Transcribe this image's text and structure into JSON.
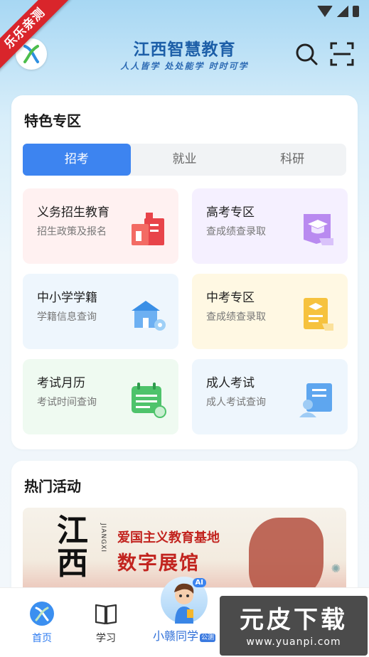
{
  "ribbon": "乐乐亲测",
  "header": {
    "title": "江西智慧教育",
    "slogan": "人人皆学 处处能学 时时可学"
  },
  "featured": {
    "title": "特色专区",
    "tabs": [
      {
        "label": "招考",
        "active": true
      },
      {
        "label": "就业",
        "active": false
      },
      {
        "label": "科研",
        "active": false
      }
    ],
    "tiles": [
      {
        "title": "义务招生教育",
        "subtitle": "招生政策及报名",
        "icon": "school-building-icon",
        "bg": "#fff1f1"
      },
      {
        "title": "高考专区",
        "subtitle": "查成绩查录取",
        "icon": "graduation-book-icon",
        "bg": "#f5f0ff"
      },
      {
        "title": "中小学学籍",
        "subtitle": "学籍信息查询",
        "icon": "school-house-icon",
        "bg": "#eef6fd"
      },
      {
        "title": "中考专区",
        "subtitle": "查成绩查录取",
        "icon": "certificate-icon",
        "bg": "#fff8e3"
      },
      {
        "title": "考试月历",
        "subtitle": "考试时间查询",
        "icon": "calendar-icon",
        "bg": "#effaf1"
      },
      {
        "title": "成人考试",
        "subtitle": "成人考试查询",
        "icon": "adult-student-icon",
        "bg": "#eef6fd"
      }
    ]
  },
  "hot": {
    "title": "热门活动",
    "banner": {
      "calligraphy": "江西",
      "vertical": "JIANGXI",
      "line1": "爱国主义教育基地",
      "line2": "数字展馆"
    }
  },
  "nav": {
    "home": "首页",
    "study": "学习",
    "assistant": "小赣同学",
    "assistant_badge": "公测",
    "ai_badge": "AI"
  },
  "watermark": {
    "brand": "元皮下载",
    "url": "www.yuanpi.com"
  },
  "colors": {
    "accent": "#3d84f0",
    "title_blue": "#1d5fa8",
    "ribbon_red": "#d9252b"
  }
}
